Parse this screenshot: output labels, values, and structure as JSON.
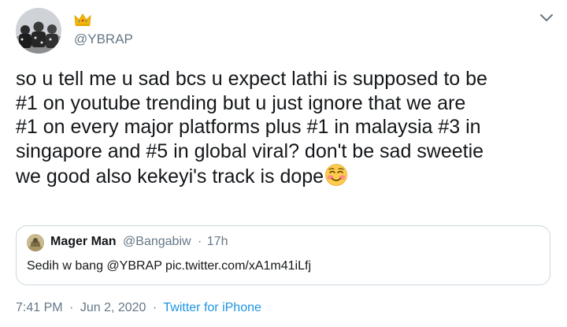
{
  "author": {
    "handle": "@YBRAP",
    "badge_icon": "crown-icon"
  },
  "tweet": {
    "lines": [
      "so u tell me u sad bcs u expect lathi is supposed to be",
      "#1 on youtube trending but u just ignore that we are",
      "#1 on every major platforms plus #1 in malaysia #3 in",
      "singapore and #5 in global viral? don't be sad sweetie",
      "we good also kekeyi's track is dope"
    ],
    "emoji": "smiling-face-with-smiling-eyes-icon"
  },
  "quoted": {
    "name": "Mager Man",
    "handle": "@Bangabiw",
    "separator": "·",
    "age": "17h",
    "text": "Sedih w bang @YBRAP pic.twitter.com/xA1m41iLfj"
  },
  "footer": {
    "time": "7:41 PM",
    "separator": "·",
    "date": "Jun 2, 2020",
    "source_sep": "·",
    "source": "Twitter for iPhone"
  },
  "colors": {
    "text": "#14171a",
    "muted": "#657786",
    "link": "#1b95e0",
    "border": "#ccd6dd"
  }
}
